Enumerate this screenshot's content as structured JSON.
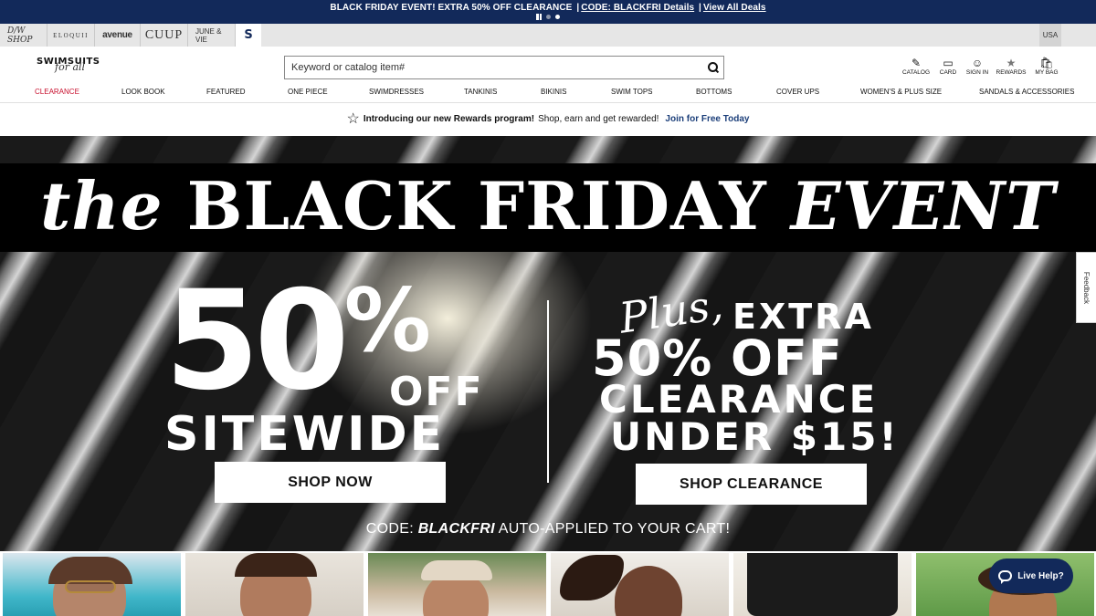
{
  "promo": {
    "text": "BLACK FRIDAY EVENT! EXTRA 50% OFF CLEARANCE",
    "sep": "|",
    "code_link": "CODE: BLACKFRI Details",
    "sep2": "|",
    "deals_link": "View All Deals",
    "slides": 3,
    "active_slide": 3
  },
  "brands": {
    "dw": "D/W SHOP",
    "eloquii": "ELOQUII",
    "avenue": "avenue",
    "cuup": "CUUP",
    "june": "JUNE & VIE",
    "current": "S"
  },
  "country": "USA",
  "logo": {
    "main": "SWIMSUITS",
    "sub": "for all"
  },
  "search": {
    "placeholder": "Keyword or catalog item#"
  },
  "utilities": {
    "catalog": "CATALOG",
    "card": "CARD",
    "sign_in": "SIGN IN",
    "rewards": "REWARDS",
    "bag": "MY BAG"
  },
  "nav": [
    "CLEARANCE",
    "LOOK BOOK",
    "FEATURED",
    "ONE PIECE",
    "SWIMDRESSES",
    "TANKINIS",
    "BIKINIS",
    "SWIM TOPS",
    "BOTTOMS",
    "COVER UPS",
    "WOMEN'S & PLUS SIZE",
    "SANDALS & ACCESSORIES"
  ],
  "rewards_strip": {
    "bold": "Introducing our new Rewards program!",
    "text": "Shop, earn and get rewarded!",
    "link": "Join for Free Today"
  },
  "hero": {
    "title_the": "the",
    "title_main": "BLACK FRIDAY",
    "title_event": "EVENT",
    "pct_num": "50",
    "pct_sign": "%",
    "off": "OFF",
    "sitewide": "SITEWIDE",
    "plus": "Plus,",
    "extra": "EXTRA",
    "fifty_off": "50% OFF",
    "clearance": "CLEARANCE",
    "under": "UNDER $15!",
    "shop_now": "SHOP NOW",
    "shop_clearance": "SHOP CLEARANCE",
    "code_prefix": "CODE:",
    "code": "BLACKFRI",
    "code_suffix": "AUTO-APPLIED TO YOUR CART!"
  },
  "feedback": "Feedback",
  "live_help": "Live Help?",
  "colors": {
    "navy": "#12295a",
    "clearance_red": "#c8102e",
    "link_blue": "#1c3f7a"
  }
}
